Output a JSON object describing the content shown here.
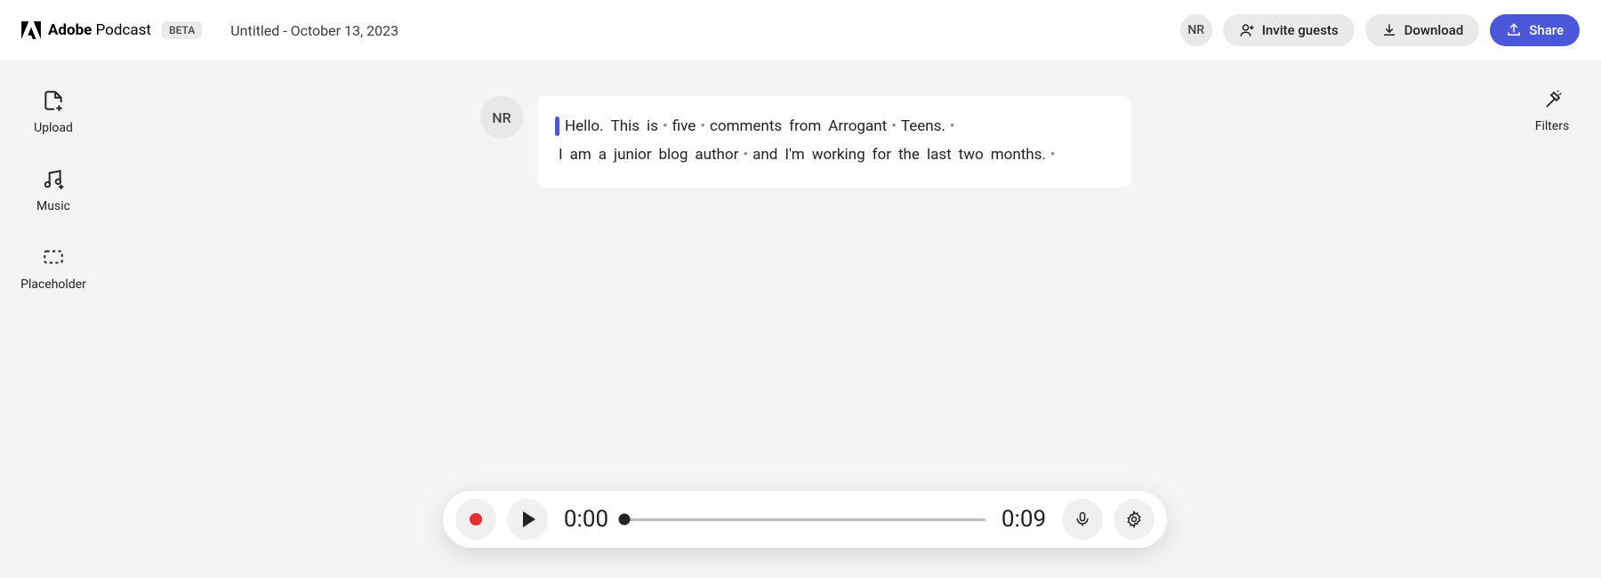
{
  "header": {
    "brand_bold": "Adobe",
    "brand_light": "Podcast",
    "beta": "BETA",
    "doc_title": "Untitled - October 13, 2023",
    "user_initials": "NR",
    "invite_label": "Invite guests",
    "download_label": "Download",
    "share_label": "Share"
  },
  "left_tools": {
    "upload": "Upload",
    "music": "Music",
    "placeholder": "Placeholder"
  },
  "right_tools": {
    "filters": "Filters"
  },
  "transcript": {
    "speaker_initials": "NR",
    "line1": [
      "Hello.",
      "This",
      "is",
      "•",
      "five",
      "•",
      "comments",
      "from",
      "Arrogant",
      "•",
      "Teens.",
      "•"
    ],
    "line2": [
      "I",
      "am",
      "a",
      "junior",
      "blog",
      "author",
      "•",
      "and",
      "I'm",
      "working",
      "for",
      "the",
      "last",
      "two",
      "months.",
      "•"
    ]
  },
  "player": {
    "current_time": "0:00",
    "total_time": "0:09"
  }
}
